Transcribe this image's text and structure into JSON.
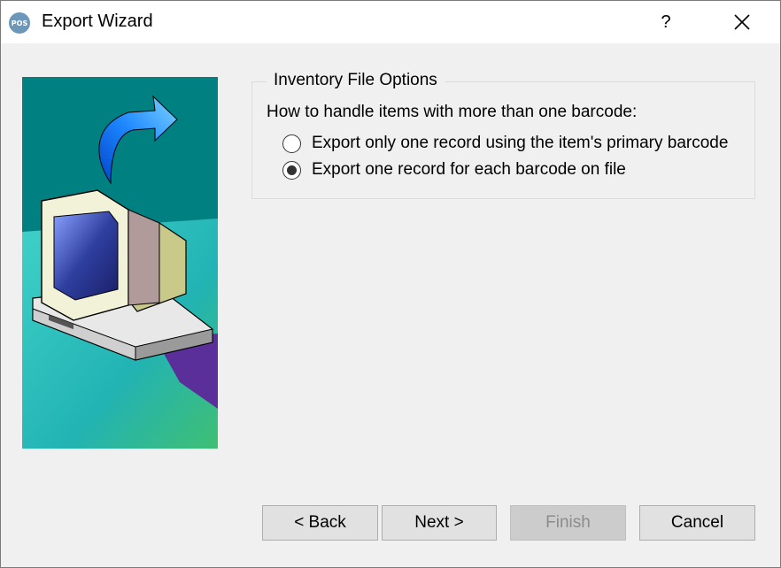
{
  "window": {
    "title": "Export Wizard",
    "app_icon_text": "POS",
    "help_label": "?",
    "close_icon": "close-icon"
  },
  "options": {
    "group_label": "Inventory File Options",
    "question": "How to handle items with more than one barcode:",
    "radios": [
      {
        "label": "Export only one record using the item's primary barcode",
        "checked": false
      },
      {
        "label": "Export one record for each barcode on file",
        "checked": true
      }
    ]
  },
  "buttons": {
    "back": "< Back",
    "next": "Next >",
    "finish": "Finish",
    "cancel": "Cancel"
  },
  "colors": {
    "sidebar_bg": "#008080",
    "arrow": "#1e88ff",
    "titlebar": "#ffffff",
    "dialog_bg": "#f0f0f0"
  }
}
